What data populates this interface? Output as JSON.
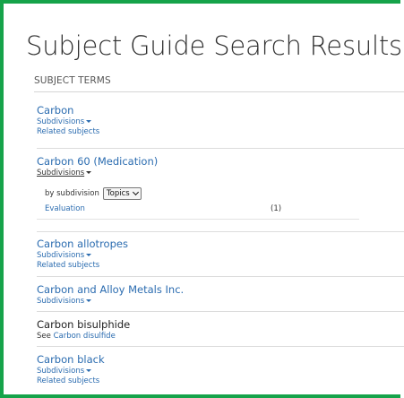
{
  "page": {
    "title": "Subject Guide Search Results",
    "section_label": "SUBJECT TERMS",
    "accent_color": "#16a34a",
    "link_color": "#2b6cb0"
  },
  "results": [
    {
      "title": "Carbon",
      "subdivisions_label": "Subdivisions",
      "related_label": "Related subjects"
    },
    {
      "title": "Carbon 60 (Medication)",
      "subdivisions_label": "Subdivisions",
      "filter": {
        "label": "by subdivision",
        "selected": "Topics"
      },
      "subdivision_rows": [
        {
          "name": "Evaluation",
          "count": "(1)"
        }
      ]
    },
    {
      "title": "Carbon allotropes",
      "subdivisions_label": "Subdivisions",
      "related_label": "Related subjects"
    },
    {
      "title": "Carbon and Alloy Metals Inc.",
      "subdivisions_label": "Subdivisions"
    },
    {
      "title": "Carbon bisulphide",
      "see_prefix": "See",
      "see_target": "Carbon disulfide"
    },
    {
      "title": "Carbon black",
      "subdivisions_label": "Subdivisions",
      "related_label": "Related subjects"
    }
  ]
}
